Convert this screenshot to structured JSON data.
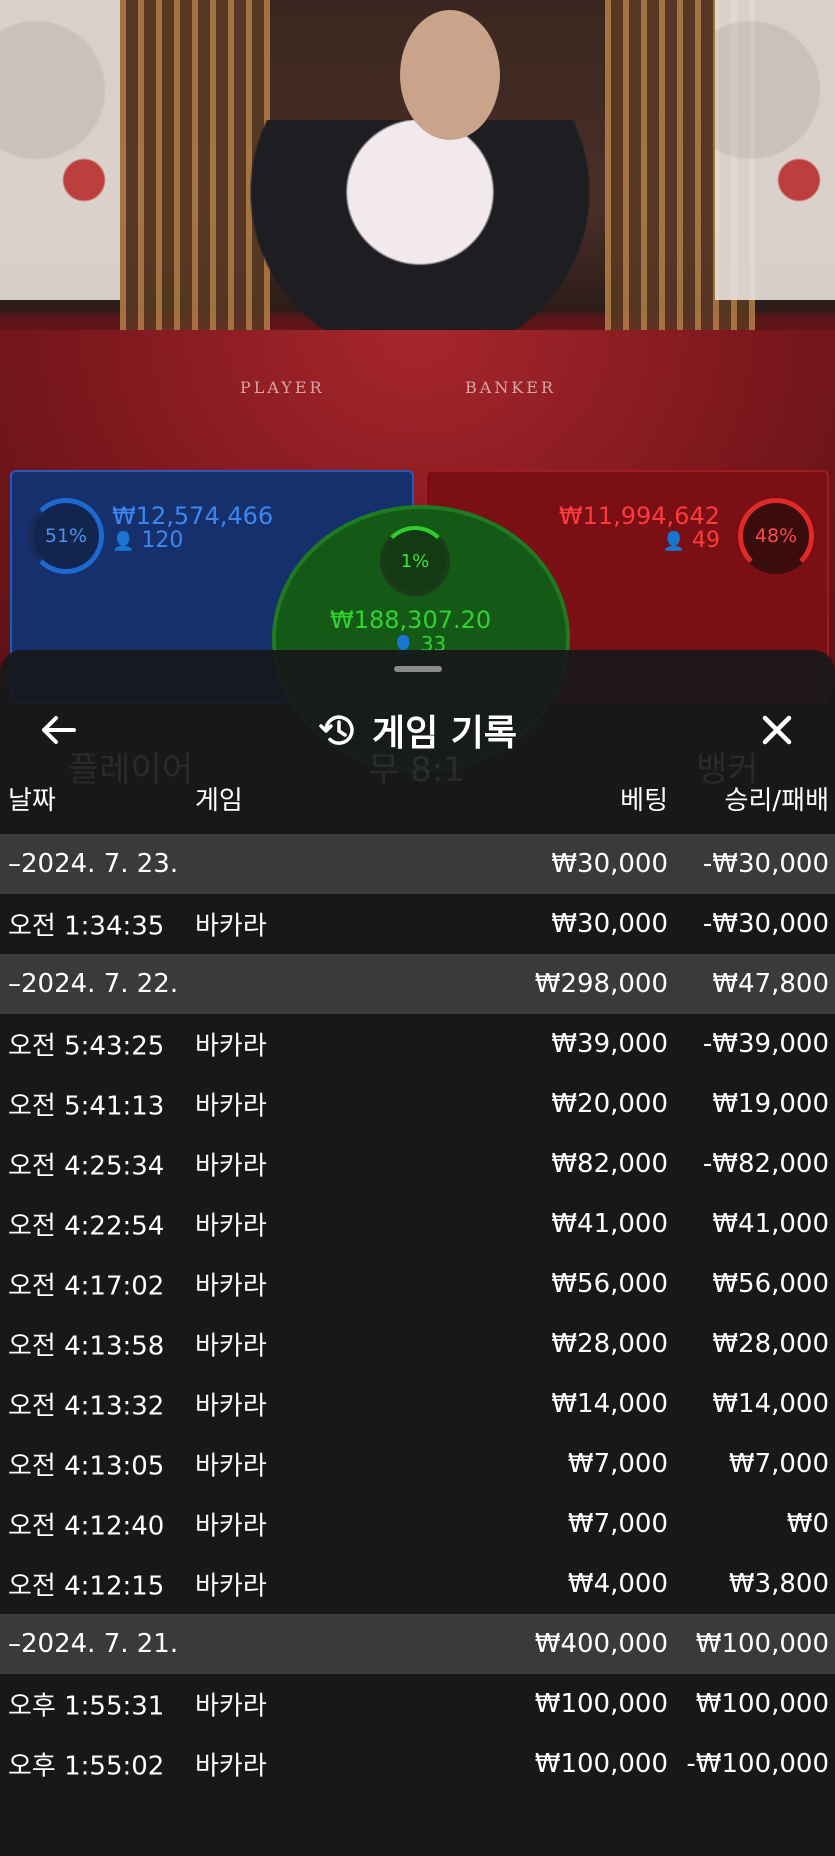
{
  "table": {
    "felt_labels": [
      "PLAYER",
      "BANKER"
    ],
    "player": {
      "percent": "51%",
      "amount": "₩12,574,466",
      "count": "120"
    },
    "banker": {
      "percent": "48%",
      "amount": "₩11,994,642",
      "count": "49"
    },
    "tie": {
      "percent": "1%",
      "amount": "₩188,307.20",
      "count": "33"
    }
  },
  "background_text": {
    "player": "플레이어",
    "tie": "무 8:1",
    "banker": "뱅커"
  },
  "sheet": {
    "title": "게임 기록",
    "columns": {
      "date": "날짜",
      "game": "게임",
      "bet": "베팅",
      "result": "승리/패배"
    },
    "rows": [
      {
        "type": "group",
        "date": "–2024. 7. 23.",
        "game": "",
        "bet": "₩30,000",
        "result": "-₩30,000"
      },
      {
        "type": "item",
        "date": "오전 1:34:35",
        "game": "바카라",
        "bet": "₩30,000",
        "result": "-₩30,000"
      },
      {
        "type": "group",
        "date": "–2024. 7. 22.",
        "game": "",
        "bet": "₩298,000",
        "result": "₩47,800"
      },
      {
        "type": "item",
        "date": "오전 5:43:25",
        "game": "바카라",
        "bet": "₩39,000",
        "result": "-₩39,000"
      },
      {
        "type": "item",
        "date": "오전 5:41:13",
        "game": "바카라",
        "bet": "₩20,000",
        "result": "₩19,000"
      },
      {
        "type": "item",
        "date": "오전 4:25:34",
        "game": "바카라",
        "bet": "₩82,000",
        "result": "-₩82,000"
      },
      {
        "type": "item",
        "date": "오전 4:22:54",
        "game": "바카라",
        "bet": "₩41,000",
        "result": "₩41,000"
      },
      {
        "type": "item",
        "date": "오전 4:17:02",
        "game": "바카라",
        "bet": "₩56,000",
        "result": "₩56,000"
      },
      {
        "type": "item",
        "date": "오전 4:13:58",
        "game": "바카라",
        "bet": "₩28,000",
        "result": "₩28,000"
      },
      {
        "type": "item",
        "date": "오전 4:13:32",
        "game": "바카라",
        "bet": "₩14,000",
        "result": "₩14,000"
      },
      {
        "type": "item",
        "date": "오전 4:13:05",
        "game": "바카라",
        "bet": "₩7,000",
        "result": "₩7,000"
      },
      {
        "type": "item",
        "date": "오전 4:12:40",
        "game": "바카라",
        "bet": "₩7,000",
        "result": "₩0"
      },
      {
        "type": "item",
        "date": "오전 4:12:15",
        "game": "바카라",
        "bet": "₩4,000",
        "result": "₩3,800"
      },
      {
        "type": "group",
        "date": "–2024. 7. 21.",
        "game": "",
        "bet": "₩400,000",
        "result": "₩100,000"
      },
      {
        "type": "item",
        "date": "오후 1:55:31",
        "game": "바카라",
        "bet": "₩100,000",
        "result": "₩100,000"
      },
      {
        "type": "item",
        "date": "오후 1:55:02",
        "game": "바카라",
        "bet": "₩100,000",
        "result": "-₩100,000"
      }
    ]
  },
  "colors": {
    "player": "#3e86ee",
    "banker": "#ff3a3a",
    "tie": "#31d331",
    "group_row": "#3a3a3c"
  }
}
